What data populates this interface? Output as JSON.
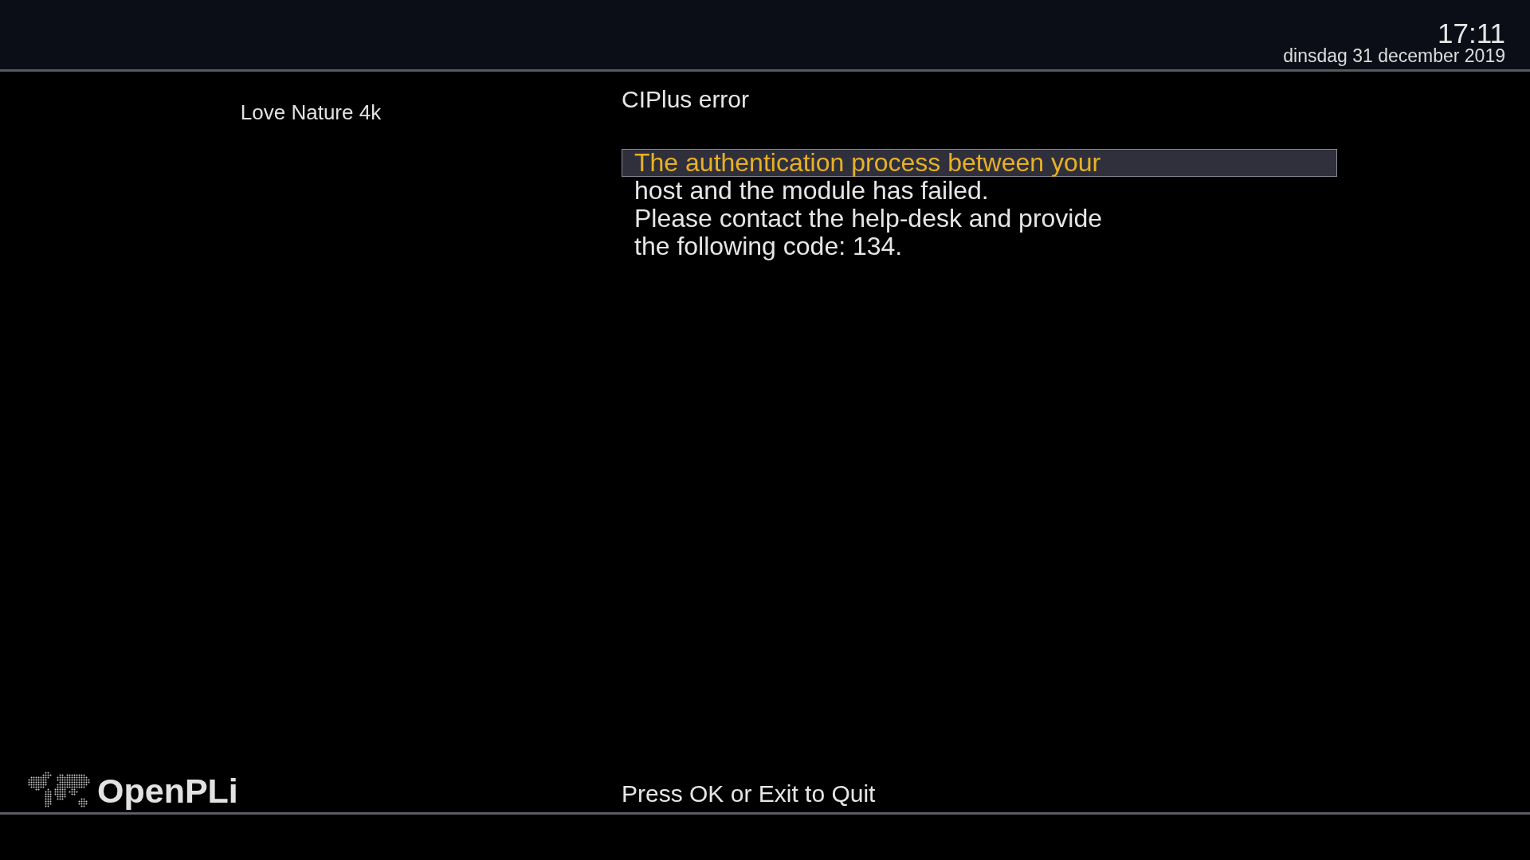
{
  "header": {
    "time": "17:11",
    "date": "dinsdag 31 december 2019"
  },
  "channel": {
    "name": "Love Nature 4k"
  },
  "dialog": {
    "title": "CIPlus error",
    "lines": [
      {
        "text": "The authentication process between your",
        "selected": true
      },
      {
        "text": "host and the module has failed.",
        "selected": false
      },
      {
        "text": "Please contact the help-desk and provide",
        "selected": false
      },
      {
        "text": "the following code: 134.",
        "selected": false
      }
    ]
  },
  "logo": {
    "text": "OpenPLi"
  },
  "footer": {
    "hint": "Press OK or Exit to Quit"
  }
}
